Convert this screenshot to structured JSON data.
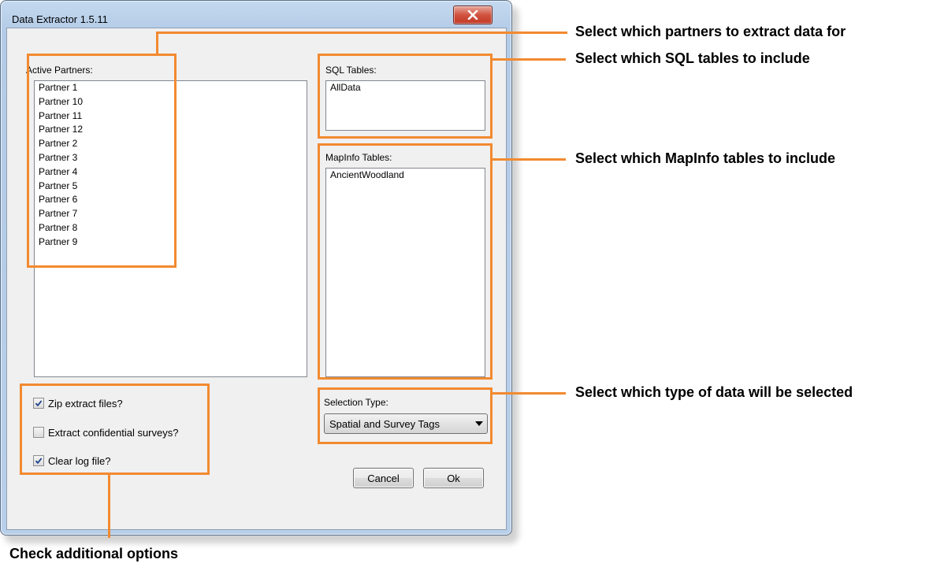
{
  "window": {
    "title": "Data Extractor 1.5.11"
  },
  "partners": {
    "label": "Active Partners:",
    "items": [
      "Partner 1",
      "Partner 10",
      "Partner 11",
      "Partner 12",
      "Partner 2",
      "Partner 3",
      "Partner 4",
      "Partner 5",
      "Partner 6",
      "Partner 7",
      "Partner 8",
      "Partner 9"
    ]
  },
  "sql_tables": {
    "label": "SQL Tables:",
    "items": [
      "AllData"
    ]
  },
  "mapinfo_tables": {
    "label": "MapInfo Tables:",
    "items": [
      "AncientWoodland"
    ]
  },
  "options": {
    "zip": {
      "label": "Zip extract files?",
      "checked": true
    },
    "confidential": {
      "label": "Extract confidential surveys?",
      "checked": false
    },
    "clear_log": {
      "label": "Clear log file?",
      "checked": true
    }
  },
  "selection": {
    "label": "Selection Type:",
    "value": "Spatial and Survey Tags"
  },
  "buttons": {
    "cancel": "Cancel",
    "ok": "Ok"
  },
  "annotations": {
    "partners": "Select which partners to extract data for",
    "sql": "Select which SQL tables to include",
    "mapinfo": "Select which MapInfo tables to include",
    "selection": "Select which type of data will be selected",
    "options": "Check additional options"
  },
  "colors": {
    "highlight": "#f28a30",
    "close_button": "#c33a26",
    "dialog_face": "#f0f0f0"
  }
}
